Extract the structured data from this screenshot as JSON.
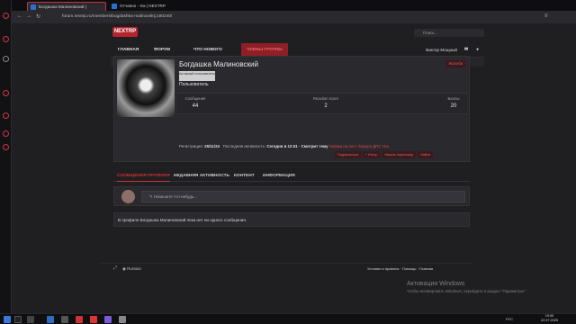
{
  "browser": {
    "tabs": [
      {
        "label": "Богдашка Малиновский |",
        "active": true
      },
      {
        "label": "Отчаяно - Хм | NEXTRP",
        "active": false
      }
    ],
    "url": "forum.nextrp.ru/members/bogdashka-malinovskij.180240/"
  },
  "site": {
    "logo": "NEXTRP",
    "search_placeholder": "Поиск...",
    "nav": [
      "ГЛАВНАЯ",
      "ФОРУМ",
      "ЧТО НОВОГО",
      "ЧЛЕНЫ ГРУППЫ"
    ],
    "user": "Виктор Мощный",
    "subnav": [
      "Сейчас на форуме",
      "Новые сообщения профиля",
      "Поиск сообщений профиля"
    ]
  },
  "profile": {
    "name": "Богдашка Малиновский",
    "badge": "Активный пользователь",
    "role": "Пользователь",
    "report": "Жалоба",
    "stats": [
      {
        "label": "Сообщения",
        "value": "44"
      },
      {
        "label": "Reaction score",
        "value": "2"
      },
      {
        "label": "Баллы",
        "value": "20"
      }
    ],
    "registration_label": "Регистрация:",
    "registration_value": "25/11/24",
    "last_activity_label": "Последняя активность:",
    "last_activity_value": "Сегодня в 12:51 · Смотрит тему",
    "last_activity_link": "Заявка на пост Лидера ДПС Нск",
    "actions": [
      "Подписаться",
      "+ Игнор",
      "Начать переписку",
      "Найти"
    ]
  },
  "profile_tabs": [
    "СООБЩЕНИЯ ПРОФИЛЯ",
    "НЕДАВНЯЯ АКТИВНОСТЬ",
    "КОНТЕНТ",
    "ИНФОРМАЦИЯ"
  ],
  "composer_placeholder": "Напишите что-нибудь...",
  "empty_message": "В профиле Богдашка Малиновский пока нет ни одного сообщения.",
  "footer": {
    "language": "Russian",
    "links": "Условия и правила · Помощь · Главная"
  },
  "activation": {
    "title": "Активация Windows",
    "subtitle": "Чтобы активировать Windows, перейдите в раздел \"Параметры\"."
  },
  "taskbar": {
    "time": "19:00",
    "date": "22.07.2025",
    "lang": "РУС"
  }
}
